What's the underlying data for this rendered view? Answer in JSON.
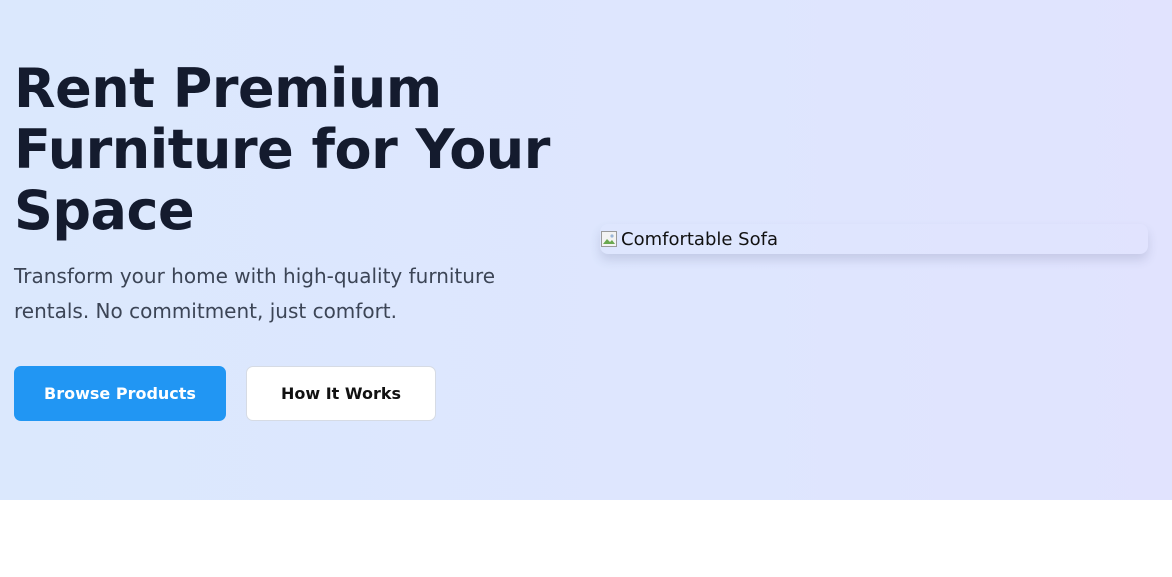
{
  "hero": {
    "title": "Rent Premium Furniture for Your Space",
    "subtitle": "Transform your home with high-quality furniture rentals. No commitment, just comfort.",
    "primary_button": "Browse Products",
    "secondary_button": "How It Works",
    "image_alt": "Comfortable Sofa"
  },
  "colors": {
    "primary": "#2196f3",
    "title": "#141b2e",
    "subtitle": "#3c4556",
    "hero_bg": "#dce7fd"
  },
  "icons": {
    "image_placeholder": "broken-image-icon"
  }
}
